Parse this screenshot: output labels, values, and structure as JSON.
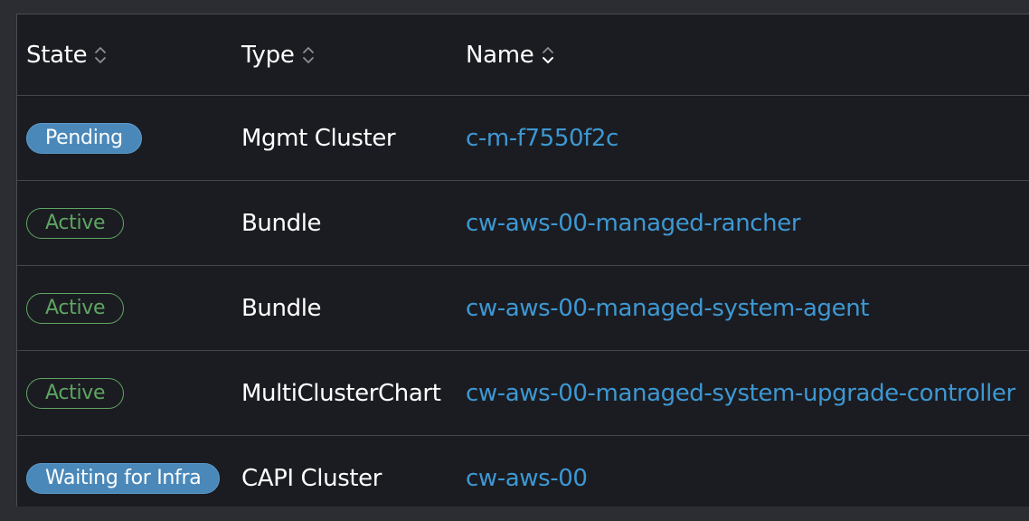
{
  "table": {
    "headers": {
      "state": "State",
      "type": "Type",
      "name": "Name"
    },
    "rows": [
      {
        "state": "Pending",
        "state_style": "info",
        "type": "Mgmt Cluster",
        "name": "c-m-f7550f2c"
      },
      {
        "state": "Active",
        "state_style": "success",
        "type": "Bundle",
        "name": "cw-aws-00-managed-rancher"
      },
      {
        "state": "Active",
        "state_style": "success",
        "type": "Bundle",
        "name": "cw-aws-00-managed-system-agent"
      },
      {
        "state": "Active",
        "state_style": "success",
        "type": "MultiClusterChart",
        "name": "cw-aws-00-managed-system-upgrade-controller"
      },
      {
        "state": "Waiting for Infra",
        "state_style": "info",
        "type": "CAPI Cluster",
        "name": "cw-aws-00"
      }
    ]
  },
  "colors": {
    "background": "#1b1c21",
    "link": "#3d98d3",
    "info_badge": "#4a88b9",
    "success_badge": "#5fa563",
    "divider": "#45464c"
  },
  "icons": {
    "sort": "sort-icon"
  }
}
